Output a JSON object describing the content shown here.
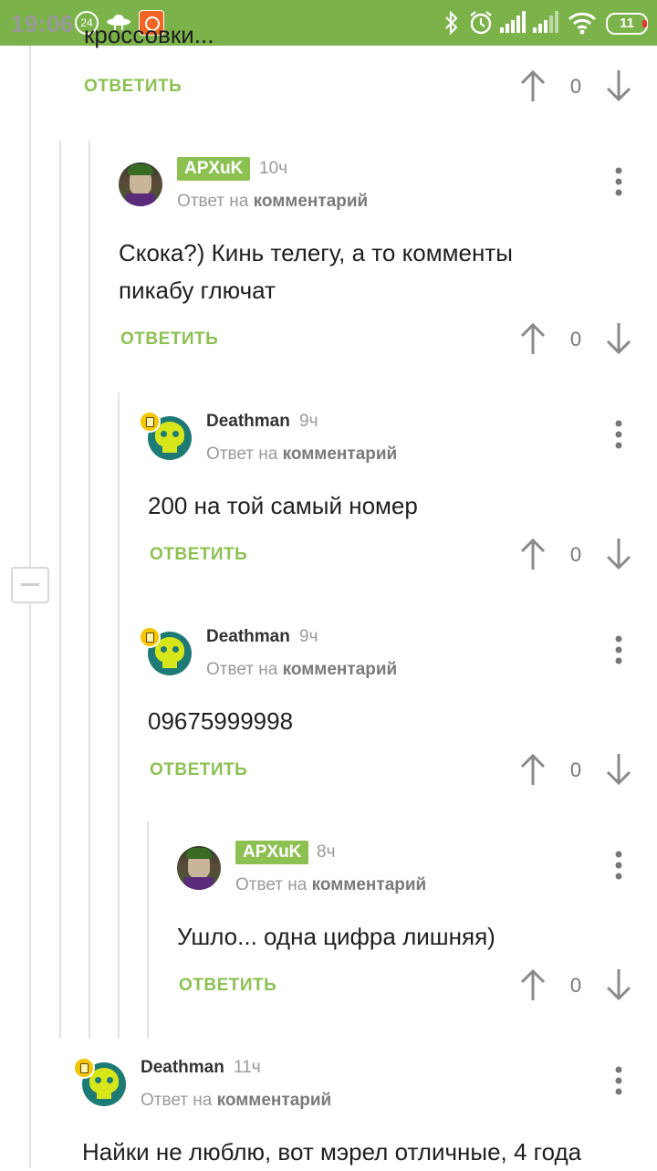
{
  "status_bar": {
    "time": "19:06",
    "notif_badge": "24",
    "battery": "11",
    "icons": [
      "ufo-icon",
      "app-notification-icon",
      "bluetooth-icon",
      "alarm-icon",
      "signal-icon",
      "signal-icon",
      "wifi-icon",
      "battery-icon"
    ]
  },
  "top": {
    "partial_text": "кроссовки...",
    "reply_label": "ОТВЕТИТЬ",
    "score": "0"
  },
  "comments": [
    {
      "author": "APXuK",
      "time": "10ч",
      "reply_prefix": "Ответ на",
      "reply_link": "комментарий",
      "text_lines": [
        "Скока?) Кинь телегу, а то комменты",
        "пикабу глючат"
      ],
      "reply_label": "ОТВЕТИТЬ",
      "score": "0"
    },
    {
      "author": "Deathman",
      "time": "9ч",
      "reply_prefix": "Ответ на",
      "reply_link": "комментарий",
      "text_lines": [
        "200 на той самый номер"
      ],
      "reply_label": "ОТВЕТИТЬ",
      "score": "0"
    },
    {
      "author": "Deathman",
      "time": "9ч",
      "reply_prefix": "Ответ на",
      "reply_link": "комментарий",
      "text_lines": [
        "09675999998"
      ],
      "reply_label": "ОТВЕТИТЬ",
      "score": "0"
    },
    {
      "author": "APXuK",
      "time": "8ч",
      "reply_prefix": "Ответ на",
      "reply_link": "комментарий",
      "text_lines": [
        "Ушло... одна цифра лишняя)"
      ],
      "reply_label": "ОТВЕТИТЬ",
      "score": "0"
    },
    {
      "author": "Deathman",
      "time": "11ч",
      "reply_prefix": "Ответ на",
      "reply_link": "комментарий",
      "text_lines": [
        "Найки не люблю, вот мэрел отличные, 4 года"
      ]
    }
  ],
  "colors": {
    "status_bar": "#7bb24a",
    "accent_green": "#8cc152",
    "badge_yellow": "#f4c500"
  }
}
